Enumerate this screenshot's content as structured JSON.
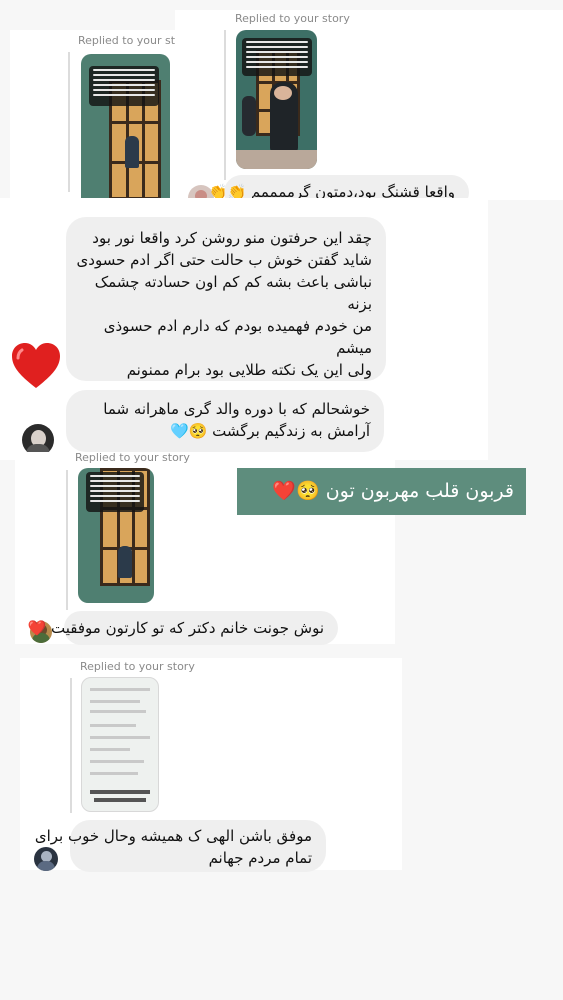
{
  "replied_label": "Replied to your story",
  "thread1": {
    "label_clipped": "Replied to your st",
    "message": "واقعا قشنگ بود،دمتون گرممممم 👏👏"
  },
  "thread2": {
    "message1": [
      "چقد این حرفتون منو روشن کرد واقعا نور بود",
      "شاید گفتن خوش ب حالت حتی اگر ادم حسودی",
      "نباشی  باعث بشه کم کم اون حسادته چشمک",
      "بزنه",
      "من خودم فهمیده بودم که دارم ادم حسوذی",
      "میشم",
      "ولی این یک نکته طلایی بود برام ممنونم"
    ],
    "reaction": "❤️",
    "message2": [
      "خوشحالم که با دوره والد گری ماهرانه شما",
      "آرامش به زندگیم برگشت 🥺🩵"
    ]
  },
  "sticker_text": "قربون قلب مهربون تون 🥺❤️",
  "thread3": {
    "message": "نوش جونت خانم دکتر که تو کارتون موفقیت ❤️"
  },
  "thread4": {
    "message": [
      "موفق باشن الهی ک همیشه وحال خوب برای",
      "تمام مردم جهانم"
    ]
  },
  "colors": {
    "bubble": "#efefef",
    "sticker_bg": "#5e8d7d",
    "story_green": "#4f7f71",
    "heart": "#e0201f"
  }
}
